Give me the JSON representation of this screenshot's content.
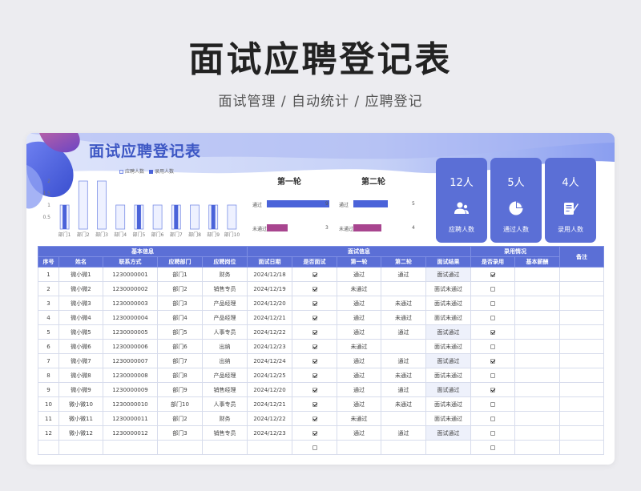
{
  "page": {
    "title": "面试应聘登记表",
    "subtitle": "面试管理 / 自动统计 / 应聘登记"
  },
  "sheet": {
    "title": "面试应聘登记表"
  },
  "chart_data": [
    {
      "type": "bar",
      "categories": [
        "部门1",
        "部门2",
        "部门3",
        "部门4",
        "部门5",
        "部门6",
        "部门7",
        "部门8",
        "部门9",
        "部门10"
      ],
      "series": [
        {
          "name": "应聘人数",
          "values": [
            1,
            2,
            2,
            1,
            1,
            1,
            1,
            1,
            1,
            1
          ]
        },
        {
          "name": "录用人数",
          "values": [
            1,
            0,
            0,
            0,
            1,
            0,
            1,
            0,
            1,
            0
          ]
        }
      ],
      "yticks": [
        "0",
        "0.5",
        "1",
        "1.5",
        "2"
      ],
      "ylim": [
        0,
        2
      ],
      "colors": {
        "applicants": "#eef1ff",
        "applicants_border": "#7b8fe6",
        "hired": "#4a63d9"
      }
    },
    {
      "type": "bar",
      "title": "第一轮",
      "categories": [
        "通过",
        "未通过"
      ],
      "values": [
        9,
        3
      ],
      "colors": [
        "#4a63d9",
        "#a8458f"
      ]
    },
    {
      "type": "bar",
      "title": "第二轮",
      "categories": [
        "通过",
        "未通过"
      ],
      "values": [
        5,
        4
      ],
      "colors": [
        "#4a63d9",
        "#a8458f"
      ]
    }
  ],
  "stats": [
    {
      "value": "12人",
      "label": "应聘人数",
      "icon": "users-icon"
    },
    {
      "value": "5人",
      "label": "通过人数",
      "icon": "pie-chart-icon"
    },
    {
      "value": "4人",
      "label": "录用人数",
      "icon": "signed-document-icon"
    }
  ],
  "table": {
    "groups": {
      "basic": "基本信息",
      "interview": "面试信息",
      "hire": "录用情况",
      "note": "备注"
    },
    "columns": [
      "序号",
      "姓名",
      "联系方式",
      "应聘部门",
      "应聘岗位",
      "面试日期",
      "是否面试",
      "第一轮",
      "第二轮",
      "面试结果",
      "是否录用",
      "基本薪酬"
    ],
    "rows": [
      {
        "no": "1",
        "name": "微小微1",
        "phone": "1230000001",
        "dept": "部门1",
        "pos": "财务",
        "date": "2024/12/18",
        "interviewed": true,
        "r1": "通过",
        "r2": "通过",
        "result": "面试通过",
        "hired": true
      },
      {
        "no": "2",
        "name": "微小微2",
        "phone": "1230000002",
        "dept": "部门2",
        "pos": "销售专员",
        "date": "2024/12/19",
        "interviewed": true,
        "r1": "未通过",
        "r2": "",
        "result": "面试未通过",
        "hired": false
      },
      {
        "no": "3",
        "name": "微小微3",
        "phone": "1230000003",
        "dept": "部门3",
        "pos": "产品经理",
        "date": "2024/12/20",
        "interviewed": true,
        "r1": "通过",
        "r2": "未通过",
        "result": "面试未通过",
        "hired": false
      },
      {
        "no": "4",
        "name": "微小微4",
        "phone": "1230000004",
        "dept": "部门4",
        "pos": "产品经理",
        "date": "2024/12/21",
        "interviewed": true,
        "r1": "通过",
        "r2": "未通过",
        "result": "面试未通过",
        "hired": false
      },
      {
        "no": "5",
        "name": "微小微5",
        "phone": "1230000005",
        "dept": "部门5",
        "pos": "人事专员",
        "date": "2024/12/22",
        "interviewed": true,
        "r1": "通过",
        "r2": "通过",
        "result": "面试通过",
        "hired": true
      },
      {
        "no": "6",
        "name": "微小微6",
        "phone": "1230000006",
        "dept": "部门6",
        "pos": "出纳",
        "date": "2024/12/23",
        "interviewed": true,
        "r1": "未通过",
        "r2": "",
        "result": "面试未通过",
        "hired": false
      },
      {
        "no": "7",
        "name": "微小微7",
        "phone": "1230000007",
        "dept": "部门7",
        "pos": "出纳",
        "date": "2024/12/24",
        "interviewed": true,
        "r1": "通过",
        "r2": "通过",
        "result": "面试通过",
        "hired": true
      },
      {
        "no": "8",
        "name": "微小微8",
        "phone": "1230000008",
        "dept": "部门8",
        "pos": "产品经理",
        "date": "2024/12/25",
        "interviewed": true,
        "r1": "通过",
        "r2": "未通过",
        "result": "面试未通过",
        "hired": false
      },
      {
        "no": "9",
        "name": "微小微9",
        "phone": "1230000009",
        "dept": "部门9",
        "pos": "销售经理",
        "date": "2024/12/20",
        "interviewed": true,
        "r1": "通过",
        "r2": "通过",
        "result": "面试通过",
        "hired": true
      },
      {
        "no": "10",
        "name": "微小微10",
        "phone": "1230000010",
        "dept": "部门10",
        "pos": "人事专员",
        "date": "2024/12/21",
        "interviewed": true,
        "r1": "通过",
        "r2": "未通过",
        "result": "面试未通过",
        "hired": false
      },
      {
        "no": "11",
        "name": "微小微11",
        "phone": "1230000011",
        "dept": "部门2",
        "pos": "财务",
        "date": "2024/12/22",
        "interviewed": true,
        "r1": "未通过",
        "r2": "",
        "result": "面试未通过",
        "hired": false
      },
      {
        "no": "12",
        "name": "微小微12",
        "phone": "1230000012",
        "dept": "部门3",
        "pos": "销售专员",
        "date": "2024/12/23",
        "interviewed": true,
        "r1": "通过",
        "r2": "通过",
        "result": "面试通过",
        "hired": false
      },
      {
        "no": "",
        "name": "",
        "phone": "",
        "dept": "",
        "pos": "",
        "date": "",
        "interviewed": false,
        "r1": "",
        "r2": "",
        "result": "",
        "hired": false
      }
    ]
  },
  "colors": {
    "accent": "#5b6fd6",
    "title": "#3d57c4",
    "fail": "#a8458f"
  }
}
